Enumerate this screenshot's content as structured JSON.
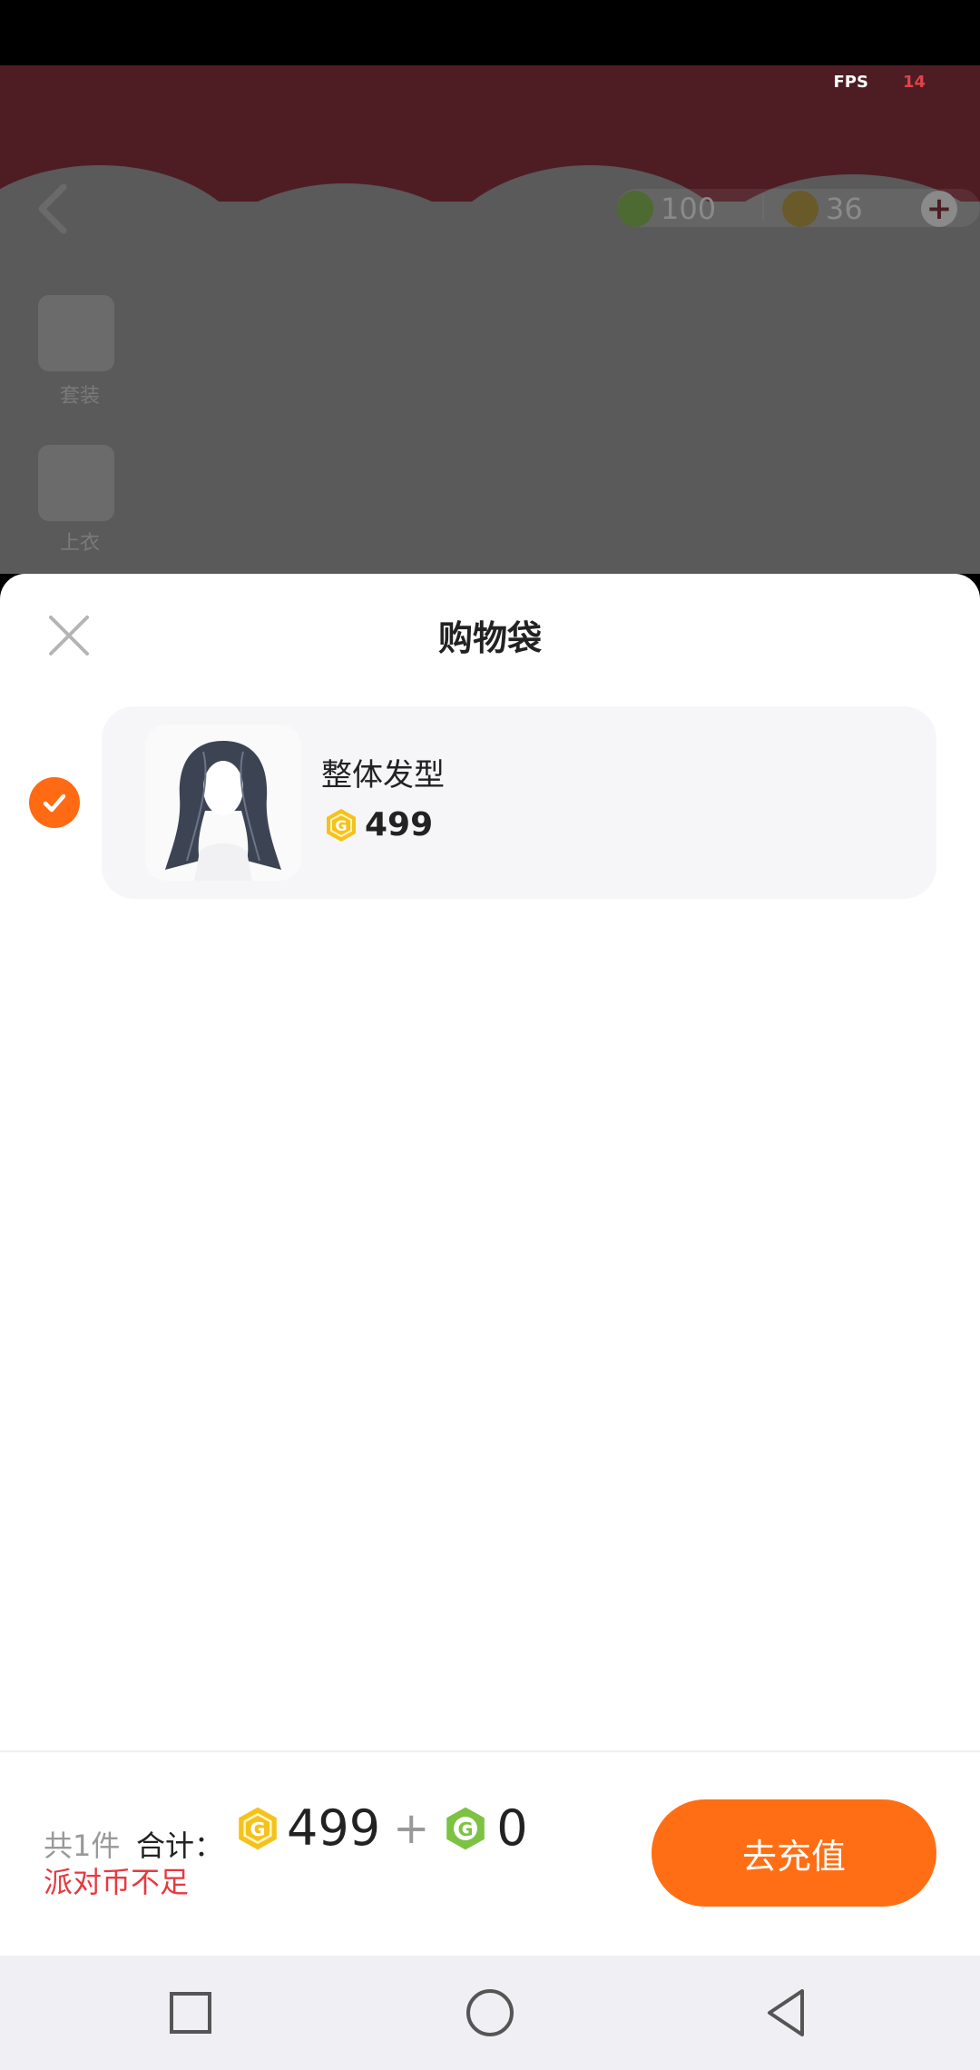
{
  "status_bar": {},
  "debug": {
    "fps_label": "FPS",
    "fps_value": "14"
  },
  "background": {
    "currency_green": "100",
    "currency_gold": "36",
    "side_labels": [
      "套装",
      "上衣"
    ]
  },
  "sheet": {
    "title": "购物袋",
    "items": [
      {
        "name": "整体发型",
        "price": "499",
        "currency_icon": "gold-coin-icon",
        "selected": true
      }
    ],
    "footer": {
      "count": "共1件",
      "total_label": "合计：",
      "gold_total": "499",
      "plus": "+",
      "green_total": "0",
      "warning": "派对币不足",
      "button_label": "去充值"
    }
  },
  "colors": {
    "accent": "#ff6e14",
    "warning": "#e8393e",
    "gold": "#f5c21b",
    "green": "#7cc243"
  }
}
